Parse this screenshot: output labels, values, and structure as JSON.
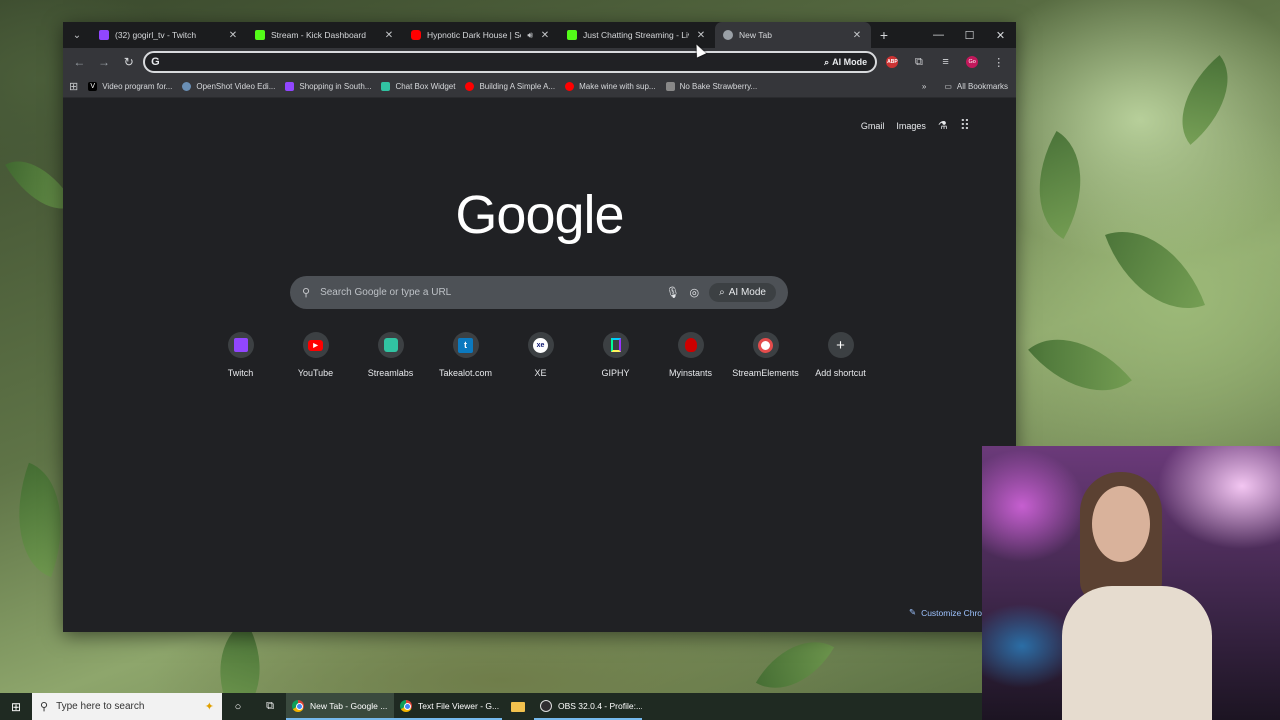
{
  "tabs": [
    {
      "title": "(32) gogirl_tv - Twitch",
      "favicon_color": "#9146ff",
      "active": false,
      "audio": false
    },
    {
      "title": "Stream - Kick Dashboard",
      "favicon_color": "#53fc18",
      "active": false,
      "audio": false
    },
    {
      "title": "Hypnotic Dark House | Sou",
      "favicon_color": "#ff0000",
      "active": false,
      "audio": true
    },
    {
      "title": "Just Chatting Streaming - Live",
      "favicon_color": "#53fc18",
      "active": false,
      "audio": false
    },
    {
      "title": "New Tab",
      "favicon_color": "#9aa0a6",
      "active": true,
      "audio": false
    }
  ],
  "toolbar": {
    "omnibox_value": "",
    "ai_mode_label": "AI Mode",
    "profile_initials": "Go",
    "abp_label": "ABP"
  },
  "bookmarks": {
    "items": [
      {
        "label": "Video program for...",
        "icon": "V",
        "color": "#000000"
      },
      {
        "label": "OpenShot Video Edi...",
        "icon": "",
        "color": "#6a8fb5"
      },
      {
        "label": "Shopping in South...",
        "icon": "",
        "color": "#9146ff"
      },
      {
        "label": "Chat Box Widget",
        "icon": "",
        "color": "#31c3a2"
      },
      {
        "label": "Building A Simple A...",
        "icon": "",
        "color": "#ff0000"
      },
      {
        "label": "Make wine with sup...",
        "icon": "",
        "color": "#ff0000"
      },
      {
        "label": "No Bake Strawberry...",
        "icon": "",
        "color": "#888888"
      }
    ],
    "all_bookmarks_label": "All Bookmarks"
  },
  "ntp": {
    "gmail_label": "Gmail",
    "images_label": "Images",
    "logo_text": "Google",
    "search_placeholder": "Search Google or type a URL",
    "ai_mode_label": "AI Mode",
    "customize_label": "Customize Chro",
    "shortcuts": [
      {
        "label": "Twitch",
        "color": "#9146ff",
        "glyph": "t"
      },
      {
        "label": "YouTube",
        "color": "#ff0000",
        "glyph": "▶"
      },
      {
        "label": "Streamlabs",
        "color": "#31c3a2",
        "glyph": "◙"
      },
      {
        "label": "Takealot.com",
        "color": "#0b79bf",
        "glyph": "t"
      },
      {
        "label": "XE",
        "color": "#0a146e",
        "glyph": "xe"
      },
      {
        "label": "GIPHY",
        "color": "#121212",
        "glyph": "▮"
      },
      {
        "label": "Myinstants",
        "color": "#cc0000",
        "glyph": "●"
      },
      {
        "label": "StreamElements",
        "color": "#e44c4c",
        "glyph": "◉"
      },
      {
        "label": "Add shortcut",
        "color": "#3c4043",
        "glyph": "+"
      }
    ]
  },
  "taskbar": {
    "search_placeholder": "Type here to search",
    "apps": [
      {
        "label": "New Tab - Google ...",
        "icon": "chrome",
        "active": true
      },
      {
        "label": "Text File Viewer - G...",
        "icon": "chrome",
        "active": false
      },
      {
        "label": "",
        "icon": "folder",
        "active": false
      },
      {
        "label": "OBS 32.0.4 - Profile:...",
        "icon": "obs",
        "active": false
      }
    ]
  }
}
